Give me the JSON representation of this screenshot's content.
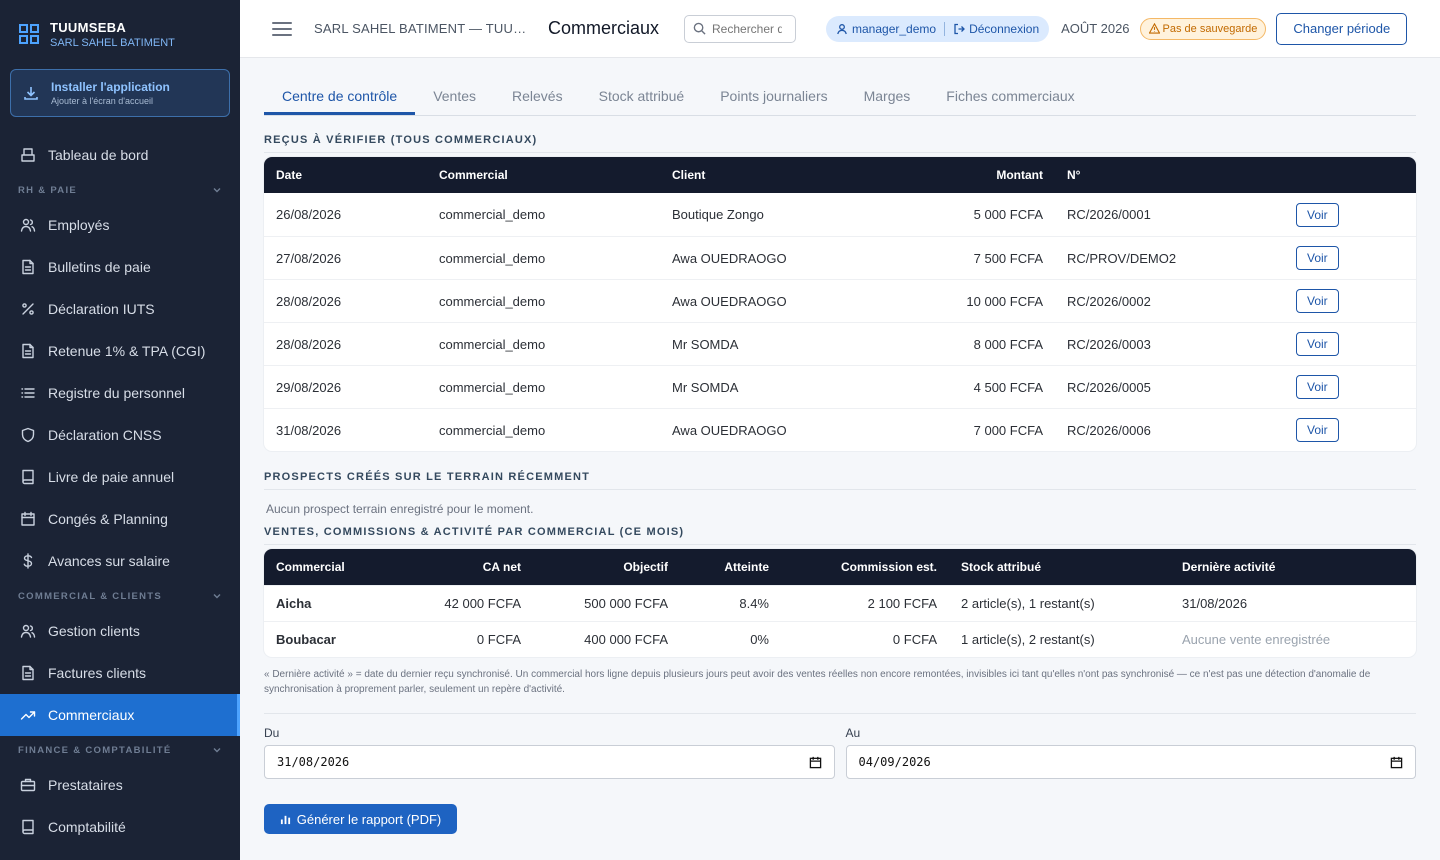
{
  "brand": {
    "name": "TUUMSEBA",
    "company": "SARL SAHEL BATIMENT"
  },
  "install": {
    "title": "Installer l'application",
    "subtitle": "Ajouter à l'écran d'accueil"
  },
  "sidebar": {
    "top": [
      {
        "label": "Tableau de bord",
        "icon": "home-icon"
      }
    ],
    "sections": [
      {
        "title": "RH & PAIE",
        "items": [
          {
            "label": "Employés",
            "icon": "users-icon"
          },
          {
            "label": "Bulletins de paie",
            "icon": "document-icon"
          },
          {
            "label": "Déclaration IUTS",
            "icon": "percent-icon"
          },
          {
            "label": "Retenue 1% & TPA (CGI)",
            "icon": "document-icon"
          },
          {
            "label": "Registre du personnel",
            "icon": "list-icon"
          },
          {
            "label": "Déclaration CNSS",
            "icon": "shield-icon"
          },
          {
            "label": "Livre de paie annuel",
            "icon": "book-icon"
          },
          {
            "label": "Congés & Planning",
            "icon": "calendar-icon"
          },
          {
            "label": "Avances sur salaire",
            "icon": "dollar-icon"
          }
        ]
      },
      {
        "title": "COMMERCIAL & CLIENTS",
        "items": [
          {
            "label": "Gestion clients",
            "icon": "users-icon"
          },
          {
            "label": "Factures clients",
            "icon": "document-icon"
          },
          {
            "label": "Commerciaux",
            "icon": "trending-icon",
            "active": true
          }
        ]
      },
      {
        "title": "FINANCE & COMPTABILITÉ",
        "items": [
          {
            "label": "Prestataires",
            "icon": "briefcase-icon"
          },
          {
            "label": "Comptabilité",
            "icon": "book-icon"
          }
        ]
      }
    ]
  },
  "topbar": {
    "breadcrumb": "SARL SAHEL BATIMENT — TUUMSEBA",
    "title": "Commerciaux",
    "search_placeholder": "Rechercher dans l'application",
    "user": "manager_demo",
    "logout": "Déconnexion",
    "period": "AOÛT 2026",
    "warning": "Pas de sauvegarde",
    "change_period": "Changer période"
  },
  "tabs": [
    "Centre de contrôle",
    "Ventes",
    "Relevés",
    "Stock attribué",
    "Points journaliers",
    "Marges",
    "Fiches commerciaux"
  ],
  "receipts": {
    "title": "REÇUS À VÉRIFIER (TOUS COMMERCIAUX)",
    "headers": [
      "Date",
      "Commercial",
      "Client",
      "Montant",
      "N°"
    ],
    "action_label": "Voir",
    "rows": [
      [
        "26/08/2026",
        "commercial_demo",
        "Boutique Zongo",
        "5 000 FCFA",
        "RC/2026/0001"
      ],
      [
        "27/08/2026",
        "commercial_demo",
        "Awa OUEDRAOGO",
        "7 500 FCFA",
        "RC/PROV/DEMO2"
      ],
      [
        "28/08/2026",
        "commercial_demo",
        "Awa OUEDRAOGO",
        "10 000 FCFA",
        "RC/2026/0002"
      ],
      [
        "28/08/2026",
        "commercial_demo",
        "Mr SOMDA",
        "8 000 FCFA",
        "RC/2026/0003"
      ],
      [
        "29/08/2026",
        "commercial_demo",
        "Mr SOMDA",
        "4 500 FCFA",
        "RC/2026/0005"
      ],
      [
        "31/08/2026",
        "commercial_demo",
        "Awa OUEDRAOGO",
        "7 000 FCFA",
        "RC/2026/0006"
      ]
    ]
  },
  "prospects": {
    "title": "PROSPECTS CRÉÉS SUR LE TERRAIN RÉCEMMENT",
    "empty": "Aucun prospect terrain enregistré pour le moment."
  },
  "sales": {
    "title": "VENTES, COMMISSIONS & ACTIVITÉ PAR COMMERCIAL (CE MOIS)",
    "headers": [
      "Commercial",
      "CA net",
      "Objectif",
      "Atteinte",
      "Commission est.",
      "Stock attribué",
      "Dernière activité"
    ],
    "rows": [
      [
        "Aicha",
        "42 000 FCFA",
        "500 000 FCFA",
        "8.4%",
        "2 100 FCFA",
        "2 article(s), 1 restant(s)",
        "31/08/2026"
      ],
      [
        "Boubacar",
        "0 FCFA",
        "400 000 FCFA",
        "0%",
        "0 FCFA",
        "1 article(s), 2 restant(s)",
        "Aucune vente enregistrée"
      ]
    ],
    "note": "« Dernière activité » = date du dernier reçu synchronisé. Un commercial hors ligne depuis plusieurs jours peut avoir des ventes réelles non encore remontées, invisibles ici tant qu'elles n'ont pas synchronisé — ce n'est pas une détection d'anomalie de synchronisation à proprement parler, seulement un repère d'activité."
  },
  "report": {
    "from_label": "Du",
    "from_value": "31/08/2026",
    "to_label": "Au",
    "to_value": "04/09/2026",
    "generate": "Générer le rapport (PDF)"
  },
  "colors": {
    "sidebar_bg": "#1b2335",
    "active": "#1e6fd0",
    "table_head": "#141b2d",
    "accent": "#1e56a8",
    "warning": "#c26a00"
  }
}
